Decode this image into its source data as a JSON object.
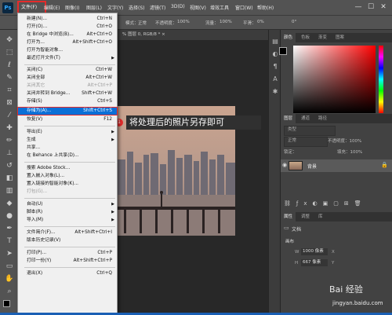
{
  "menubar": {
    "app_logo": "Ps",
    "items": [
      "文件(F)",
      "编辑(E)",
      "图像(I)",
      "图层(L)",
      "文字(Y)",
      "选择(S)",
      "滤镜(T)",
      "3D(D)",
      "视图(V)",
      "增效工具",
      "窗口(W)",
      "帮助(H)"
    ],
    "window_controls": [
      "—",
      "☐",
      "✕"
    ]
  },
  "optionsbar": {
    "mode_label": "模式：",
    "mode_value": "正常",
    "opacity_label": "不透明度：",
    "opacity_value": "100%",
    "flow_label": "流量：",
    "flow_value": "100%",
    "smoothing_label": "平滑：",
    "smoothing_value": "0%",
    "angle_value": "0°"
  },
  "document": {
    "tab_label": "% 图层 0, RGB/8 *  ×"
  },
  "callout": {
    "number": "1",
    "text": "将处理后的照片另存即可"
  },
  "filemenu": {
    "items": [
      {
        "label": "新建(N)...",
        "shortcut": "Ctrl+N"
      },
      {
        "label": "打开(O)...",
        "shortcut": "Ctrl+O"
      },
      {
        "label": "在 Bridge 中浏览(B)...",
        "shortcut": "Alt+Ctrl+O"
      },
      {
        "label": "打开为...",
        "shortcut": "Alt+Shift+Ctrl+O"
      },
      {
        "label": "打开为智能对象...",
        "shortcut": ""
      },
      {
        "label": "最近打开文件(T)",
        "shortcut": ""
      },
      {
        "label": "关闭(C)",
        "shortcut": "Ctrl+W"
      },
      {
        "label": "关闭全部",
        "shortcut": "Alt+Ctrl+W"
      },
      {
        "label": "关闭其它",
        "shortcut": "Alt+Ctrl+P"
      },
      {
        "label": "关闭并转到 Bridge...",
        "shortcut": "Shift+Ctrl+W"
      },
      {
        "label": "存储(S)",
        "shortcut": "Ctrl+S"
      },
      {
        "label": "存储为(A)...",
        "shortcut": "Shift+Ctrl+S"
      },
      {
        "label": "恢复(V)",
        "shortcut": "F12"
      },
      {
        "label": "导出(E)",
        "shortcut": ""
      },
      {
        "label": "生成",
        "shortcut": ""
      },
      {
        "label": "共享...",
        "shortcut": ""
      },
      {
        "label": "在 Behance 上共享(D)...",
        "shortcut": ""
      },
      {
        "label": "搜索 Adobe Stock...",
        "shortcut": ""
      },
      {
        "label": "置入嵌入对象(L)...",
        "shortcut": ""
      },
      {
        "label": "置入链接的智能对象(K)...",
        "shortcut": ""
      },
      {
        "label": "打包(G)...",
        "shortcut": ""
      },
      {
        "label": "自动(U)",
        "shortcut": ""
      },
      {
        "label": "脚本(R)",
        "shortcut": ""
      },
      {
        "label": "导入(M)",
        "shortcut": ""
      },
      {
        "label": "文件简介(F)...",
        "shortcut": "Alt+Shift+Ctrl+I"
      },
      {
        "label": "版本历史记录(V)",
        "shortcut": ""
      },
      {
        "label": "打印(P)...",
        "shortcut": "Ctrl+P"
      },
      {
        "label": "打印一份(Y)",
        "shortcut": "Alt+Shift+Ctrl+P"
      },
      {
        "label": "退出(X)",
        "shortcut": "Ctrl+Q"
      }
    ]
  },
  "panels": {
    "color_tabs": [
      "颜色",
      "色板",
      "渐变",
      "图案"
    ],
    "layers_tabs": [
      "图层",
      "通道",
      "路径"
    ],
    "layer_kind": "类型",
    "blend_mode": "正常",
    "opacity": "不透明度：100%",
    "lock_label": "锁定：",
    "fill": "填充：100%",
    "layer_name": "背景",
    "props_tabs": [
      "属性",
      "调整",
      "库"
    ],
    "props_doc": "文档",
    "canvas_label": "画布",
    "width_label": "W",
    "width_value": "1000 像素",
    "height_label": "H",
    "height_value": "667 像素",
    "x_label": "X",
    "y_label": "Y"
  },
  "watermark": {
    "text": "Bai 经验",
    "url": "jingyan.baidu.com"
  },
  "colors": {
    "accent": "#0b6fd6",
    "highlight_border": "#e52b2b"
  }
}
